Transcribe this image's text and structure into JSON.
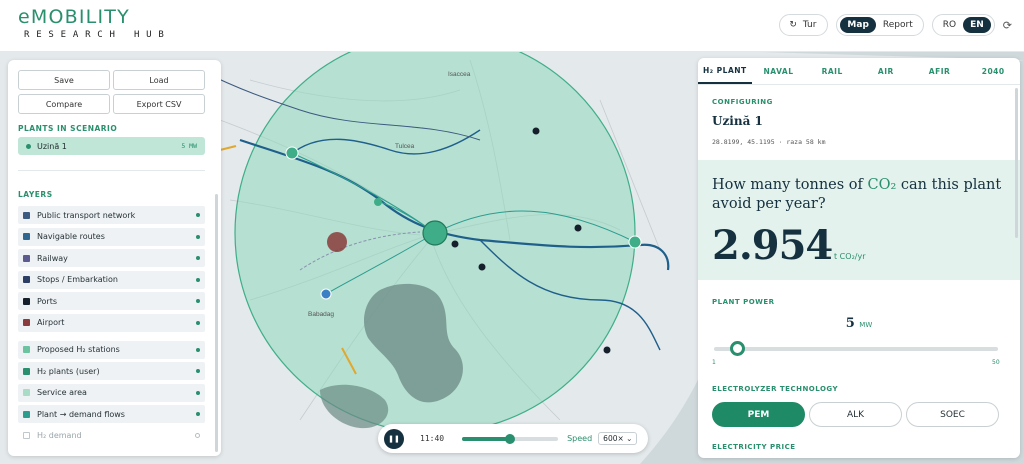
{
  "header": {
    "logo_title": "eMOBILITY",
    "logo_sub": "RESEARCH HUB",
    "tour_label": "Tur",
    "views": [
      "Map",
      "Report"
    ],
    "active_view": "Map",
    "languages": [
      "RO",
      "EN"
    ],
    "active_language": "EN"
  },
  "left": {
    "buttons": {
      "save": "Save",
      "load": "Load",
      "compare": "Compare",
      "export": "Export CSV"
    },
    "plants_title": "PLANTS IN SCENARIO",
    "plant": {
      "name": "Uzină 1",
      "power": "5 MW"
    },
    "layers_title": "LAYERS",
    "layers": [
      {
        "label": "Public transport network",
        "color": "#3d5a80",
        "on": true
      },
      {
        "label": "Navigable routes",
        "color": "#2f6690",
        "on": true
      },
      {
        "label": "Railway",
        "color": "#5b5b8f",
        "on": true
      },
      {
        "label": "Stops / Embarkation",
        "color": "#2c3e66",
        "on": true
      },
      {
        "label": "Ports",
        "color": "#15202b",
        "on": true
      },
      {
        "label": "Airport",
        "color": "#8a3b3b",
        "on": true
      },
      {
        "label": "Proposed H₂ stations",
        "color": "#6cc3a0",
        "on": true
      },
      {
        "label": "H₂ plants (user)",
        "color": "#2a8f6e",
        "on": true
      },
      {
        "label": "Service area",
        "color": "#a8dcc6",
        "on": true
      },
      {
        "label": "Plant → demand flows",
        "color": "#2a9d8f",
        "on": true
      },
      {
        "label": "H₂ demand",
        "color": "",
        "on": false
      }
    ]
  },
  "player": {
    "time": "11:40",
    "speed_label": "Speed",
    "speed": "600×",
    "progress": 0.5
  },
  "map": {
    "labels": {
      "tulcea": "Tulcea",
      "babadag": "Babadag",
      "isaccea": "Isaccea"
    },
    "colors": {
      "area": "#8fd8bc",
      "lake": "#6b8a84",
      "route": "#1f5f8b"
    }
  },
  "right": {
    "tabs": [
      "H₂ PLANT",
      "NAVAL",
      "RAIL",
      "AIR",
      "AFIR",
      "2040"
    ],
    "active_tab": "H₂ PLANT",
    "configuring_label": "CONFIGURING",
    "plant_name": "Uzină 1",
    "coords": "28.8199, 45.1195 · raza 58 km",
    "question_pre": "How many tonnes of ",
    "question_co2": "CO₂",
    "question_post": " can this plant avoid per year?",
    "big_value": "2.954",
    "big_unit": "t CO₂/yr",
    "plant_power_label": "PLANT POWER",
    "power_value": "5",
    "power_unit": "MW",
    "slider_min": "1",
    "slider_max": "50",
    "slider_value": 5,
    "electrolyzer_label": "ELECTROLYZER TECHNOLOGY",
    "technologies": [
      "PEM",
      "ALK",
      "SOEC"
    ],
    "active_technology": "PEM",
    "electricity_label": "ELECTRICITY PRICE"
  }
}
